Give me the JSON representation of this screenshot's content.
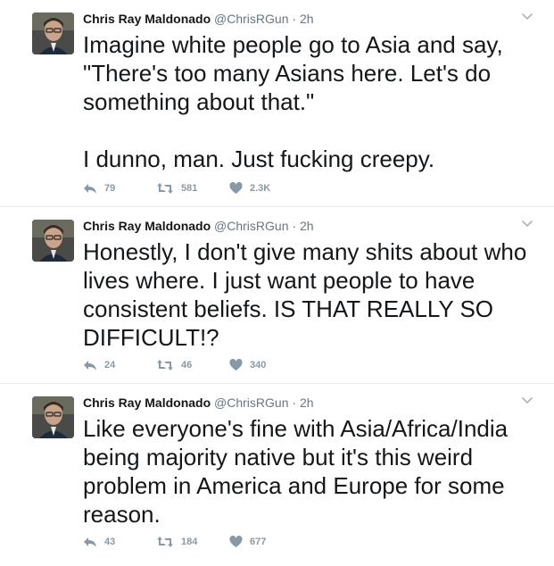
{
  "colors": {
    "text": "#14171a",
    "secondary": "#657786",
    "action_gray": "#8899a6",
    "divider": "#e6ecf0"
  },
  "icons": {
    "avatar": "user-avatar",
    "caret": "chevron-down-icon",
    "reply": "reply-icon",
    "retweet": "retweet-icon",
    "like": "heart-icon"
  },
  "tweets": [
    {
      "name": "Chris Ray Maldonado",
      "handle": "@ChrisRGun",
      "separator": "·",
      "time": "2h",
      "text": "Imagine white people go to Asia and say, \"There's too many Asians here. Let's do something about that.\"\n\nI dunno, man. Just fucking creepy.",
      "replies": "79",
      "retweets": "581",
      "likes": "2.3K"
    },
    {
      "name": "Chris Ray Maldonado",
      "handle": "@ChrisRGun",
      "separator": "·",
      "time": "2h",
      "text": "Honestly, I don't give many shits about who lives where. I just want people to have consistent beliefs. IS THAT REALLY SO DIFFICULT!?",
      "replies": "24",
      "retweets": "46",
      "likes": "340"
    },
    {
      "name": "Chris Ray Maldonado",
      "handle": "@ChrisRGun",
      "separator": "·",
      "time": "2h",
      "text": "Like everyone's fine with Asia/Africa/India being majority native but it's this weird problem in America and Europe for some reason.",
      "replies": "43",
      "retweets": "184",
      "likes": "677"
    }
  ]
}
